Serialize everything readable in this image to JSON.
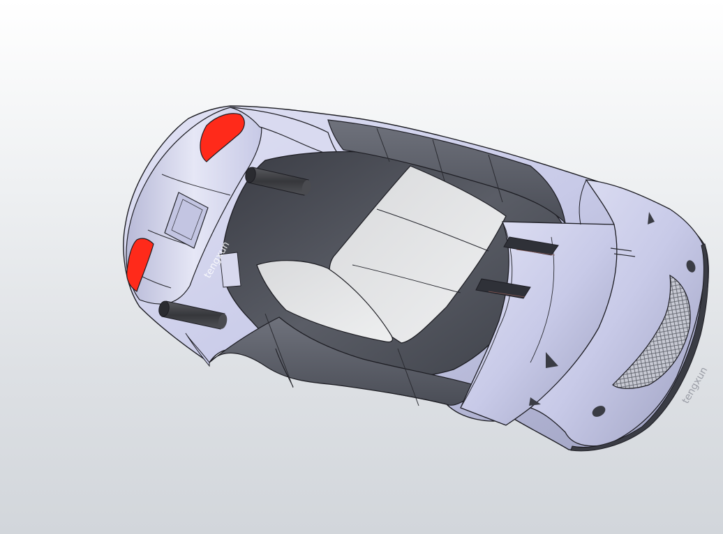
{
  "viewport": {
    "background_top": "#ffffff",
    "background_bottom": "#d2d6db"
  },
  "model": {
    "body_color": "#c8cae8",
    "dark_color": "#4a4d55",
    "glass_color": "#e4e5e7",
    "tail_light_color": "#ff2a1a",
    "pipe_color": "#3f4044"
  },
  "watermarks": [
    {
      "text": "tengxun"
    },
    {
      "text": "tengxun"
    }
  ]
}
